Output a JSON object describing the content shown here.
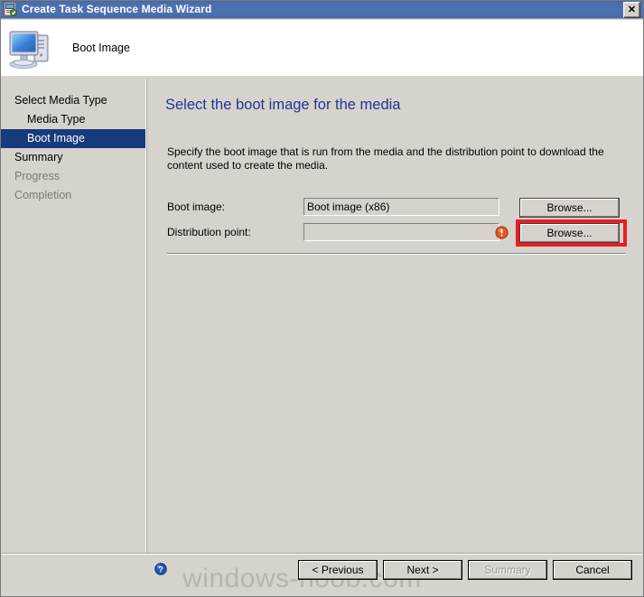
{
  "window": {
    "title": "Create Task Sequence Media Wizard",
    "title_icon": "wizard-icon",
    "close_label": "✕",
    "accent_titlebar": "#4c71b2",
    "dialog_bg": "#d6d3cd"
  },
  "header": {
    "title": "Boot Image",
    "icon": "computer-icon"
  },
  "sidebar": {
    "items": [
      {
        "label": "Select Media Type",
        "state": "normal",
        "indent": false
      },
      {
        "label": "Media Type",
        "state": "normal",
        "indent": true
      },
      {
        "label": "Boot Image",
        "state": "selected",
        "indent": true
      },
      {
        "label": "Summary",
        "state": "normal",
        "indent": false
      },
      {
        "label": "Progress",
        "state": "disabled",
        "indent": false
      },
      {
        "label": "Completion",
        "state": "disabled",
        "indent": false
      }
    ],
    "selected_color": "#173a7c"
  },
  "content": {
    "heading": "Select the boot image for the media",
    "heading_color": "#21359b",
    "description": "Specify the boot image that is run from the media and the distribution point to download the content used to create the media.",
    "fields": [
      {
        "label": "Boot image:",
        "value": "Boot image (x86)",
        "placeholder": "",
        "button_label": "Browse...",
        "has_error": false,
        "highlighted": false
      },
      {
        "label": "Distribution point:",
        "value": "",
        "placeholder": "",
        "button_label": "Browse...",
        "has_error": true,
        "error_icon": "error-exclamation-icon",
        "highlighted": true,
        "highlight_color": "#ed1c24"
      }
    ]
  },
  "footer": {
    "help_icon": "help-question-icon",
    "buttons": [
      {
        "label": "< Previous",
        "disabled": false
      },
      {
        "label": "Next >",
        "disabled": false
      },
      {
        "label": "Summary",
        "disabled": true
      },
      {
        "label": "Cancel",
        "disabled": false
      }
    ]
  },
  "watermark": {
    "text": "windows-noob.com"
  }
}
